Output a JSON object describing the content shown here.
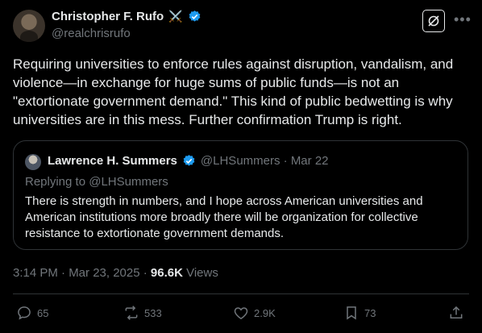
{
  "author": {
    "display_name": "Christopher F. Rufo",
    "emoji": "⚔️",
    "handle": "@realchrisrufo"
  },
  "tweet_text": "Requiring universities to enforce rules against disruption, vandalism, and violence—in exchange for huge sums of public funds—is not an \"extortionate government demand.\" This kind of public bedwetting is why universities are in this mess. Further confirmation Trump is right.",
  "quote": {
    "display_name": "Lawrence H. Summers",
    "handle_date": "@LHSummers · Mar 22",
    "replying_to": "Replying to @LHSummers",
    "text": "There is strength in numbers, and I hope across American universities and American institutions more broadly there will be organization for collective resistance to extortionate government demands."
  },
  "meta": {
    "time_date": "3:14 PM · Mar 23, 2025 · ",
    "views_count": "96.6K",
    "views_label": " Views"
  },
  "actions": {
    "replies": "65",
    "reposts": "533",
    "likes": "2.9K",
    "bookmarks": "73"
  },
  "colors": {
    "background": "#000000",
    "text": "#e7e9ea",
    "muted": "#71767b",
    "verified": "#1d9bf0",
    "border": "#2f3336"
  }
}
